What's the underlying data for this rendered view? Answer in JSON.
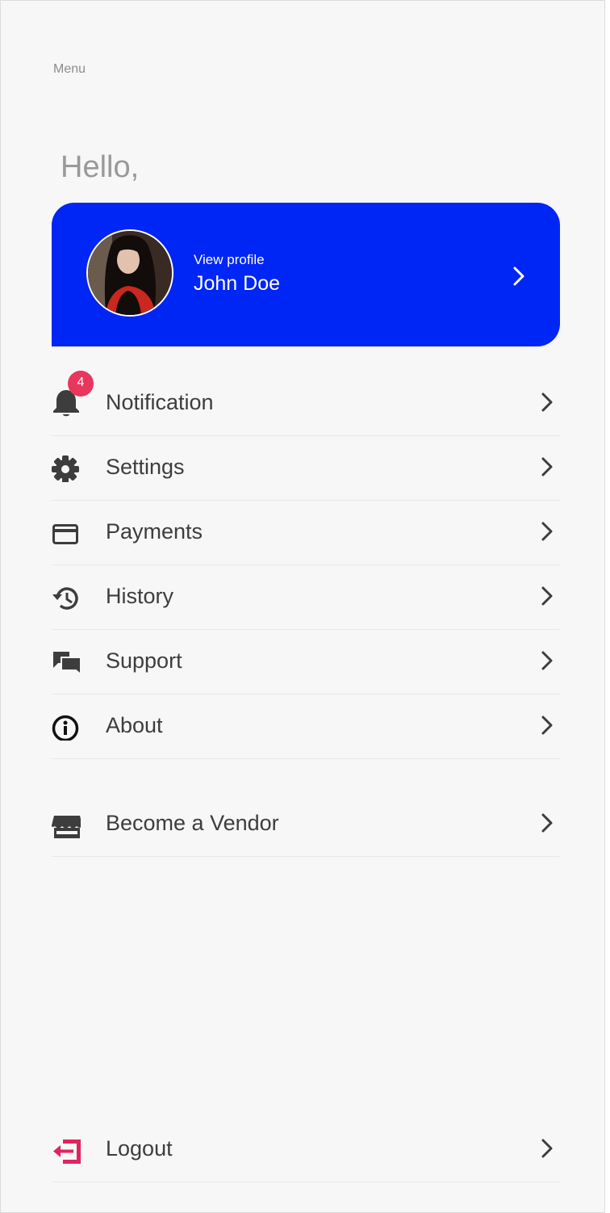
{
  "header": {
    "menu_label": "Menu",
    "greeting": "Hello,"
  },
  "profile": {
    "view_label": "View profile",
    "name": "John Doe"
  },
  "menu": {
    "items": [
      {
        "label": "Notification",
        "icon": "bell-icon",
        "badge": "4"
      },
      {
        "label": "Settings",
        "icon": "gear-icon"
      },
      {
        "label": "Payments",
        "icon": "credit-card-icon"
      },
      {
        "label": "History",
        "icon": "history-icon"
      },
      {
        "label": "Support",
        "icon": "chat-bubbles-icon"
      },
      {
        "label": "About",
        "icon": "info-icon"
      }
    ],
    "vendor": {
      "label": "Become a Vendor",
      "icon": "store-icon"
    },
    "logout": {
      "label": "Logout",
      "icon": "logout-icon"
    }
  },
  "colors": {
    "accent": "#0026f5",
    "badge": "#e8365d",
    "logout_icon": "#e0245e",
    "text": "#3d3d3d",
    "background": "#f7f7f7"
  }
}
